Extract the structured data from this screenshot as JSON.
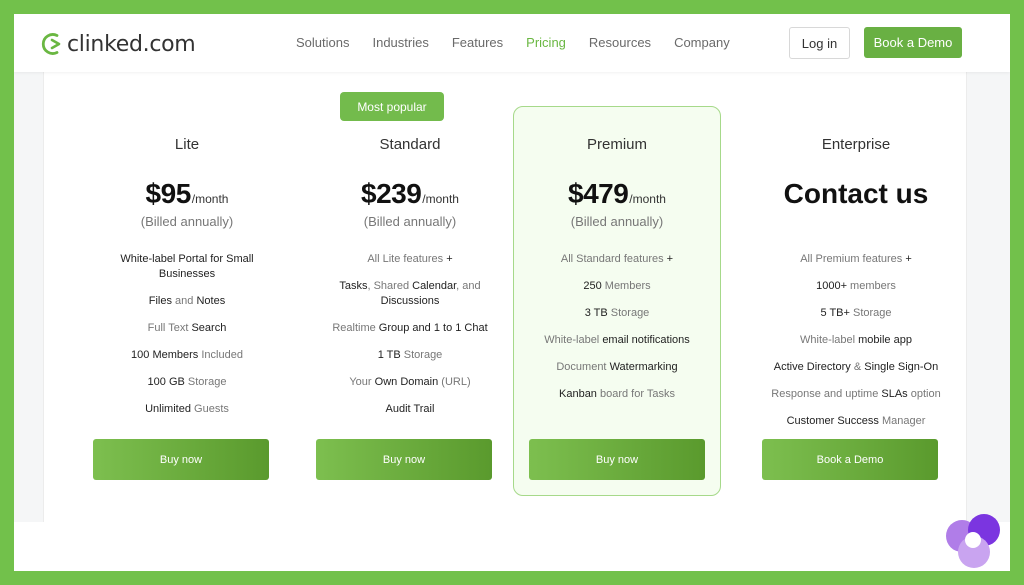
{
  "header": {
    "logo_text": "clinked.com",
    "nav": [
      {
        "label": "Solutions",
        "active": false
      },
      {
        "label": "Industries",
        "active": false
      },
      {
        "label": "Features",
        "active": false
      },
      {
        "label": "Pricing",
        "active": true
      },
      {
        "label": "Resources",
        "active": false
      },
      {
        "label": "Company",
        "active": false
      }
    ],
    "login_label": "Log in",
    "demo_label": "Book a Demo"
  },
  "badge": "Most popular",
  "plans": [
    {
      "name": "Lite",
      "price": "$95",
      "per": "/month",
      "billed": "(Billed annually)",
      "features": [
        [
          {
            "t": "White-label Portal for Small Businesses",
            "b": true
          }
        ],
        [
          {
            "t": "Files",
            "b": true
          },
          {
            "t": " and ",
            "b": false
          },
          {
            "t": "Notes",
            "b": true
          }
        ],
        [
          {
            "t": "Full Text ",
            "b": false
          },
          {
            "t": "Search",
            "b": true
          }
        ],
        [
          {
            "t": "100 Members",
            "b": true
          },
          {
            "t": " Included",
            "b": false
          }
        ],
        [
          {
            "t": "100 GB",
            "b": true
          },
          {
            "t": " Storage",
            "b": false
          }
        ],
        [
          {
            "t": "Unlimited",
            "b": true
          },
          {
            "t": " Guests",
            "b": false
          }
        ]
      ],
      "button": "Buy now"
    },
    {
      "name": "Standard",
      "price": "$239",
      "per": "/month",
      "billed": "(Billed annually)",
      "features": [
        [
          {
            "t": "All Lite features ",
            "b": false
          },
          {
            "t": "+",
            "b": true
          }
        ],
        [
          {
            "t": "Tasks",
            "b": true
          },
          {
            "t": ", Shared ",
            "b": false
          },
          {
            "t": "Calendar",
            "b": true
          },
          {
            "t": ", and ",
            "b": false
          },
          {
            "t": "Discussions",
            "b": true
          }
        ],
        [
          {
            "t": "Realtime ",
            "b": false
          },
          {
            "t": "Group and 1 to 1 Chat",
            "b": true
          }
        ],
        [
          {
            "t": "1 TB",
            "b": true
          },
          {
            "t": " Storage",
            "b": false
          }
        ],
        [
          {
            "t": "Your ",
            "b": false
          },
          {
            "t": "Own Domain",
            "b": true
          },
          {
            "t": " (URL)",
            "b": false
          }
        ],
        [
          {
            "t": "Audit Trail",
            "b": true
          }
        ]
      ],
      "button": "Buy now"
    },
    {
      "name": "Premium",
      "price": "$479",
      "per": "/month",
      "billed": "(Billed annually)",
      "features": [
        [
          {
            "t": "All Standard features ",
            "b": false
          },
          {
            "t": "+",
            "b": true
          }
        ],
        [
          {
            "t": "250",
            "b": true
          },
          {
            "t": " Members",
            "b": false
          }
        ],
        [
          {
            "t": "3 TB",
            "b": true
          },
          {
            "t": " Storage",
            "b": false
          }
        ],
        [
          {
            "t": "White-label ",
            "b": false
          },
          {
            "t": "email notifications",
            "b": true
          }
        ],
        [
          {
            "t": "Document ",
            "b": false
          },
          {
            "t": "Watermarking",
            "b": true
          }
        ],
        [
          {
            "t": "Kanban",
            "b": true
          },
          {
            "t": " board for Tasks",
            "b": false
          }
        ]
      ],
      "button": "Buy now"
    },
    {
      "name": "Enterprise",
      "contact": "Contact us",
      "features": [
        [
          {
            "t": "All Premium features ",
            "b": false
          },
          {
            "t": "+",
            "b": true
          }
        ],
        [
          {
            "t": "1000+",
            "b": true
          },
          {
            "t": " members",
            "b": false
          }
        ],
        [
          {
            "t": "5 TB+",
            "b": true
          },
          {
            "t": " Storage",
            "b": false
          }
        ],
        [
          {
            "t": "White-label ",
            "b": false
          },
          {
            "t": "mobile app",
            "b": true
          }
        ],
        [
          {
            "t": "Active Directory",
            "b": true
          },
          {
            "t": " & ",
            "b": false
          },
          {
            "t": "Single Sign-On",
            "b": true
          }
        ],
        [
          {
            "t": "Response and uptime ",
            "b": false
          },
          {
            "t": "SLAs",
            "b": true
          },
          {
            "t": " option",
            "b": false
          }
        ],
        [
          {
            "t": "Customer Success",
            "b": true
          },
          {
            "t": " Manager",
            "b": false
          }
        ]
      ],
      "button": "Book a Demo"
    }
  ],
  "colors": {
    "brand_green": "#69b043",
    "frame_green": "#72c14b",
    "highlight_border": "#a6d98a",
    "corner_purple": "#7b35e0"
  }
}
